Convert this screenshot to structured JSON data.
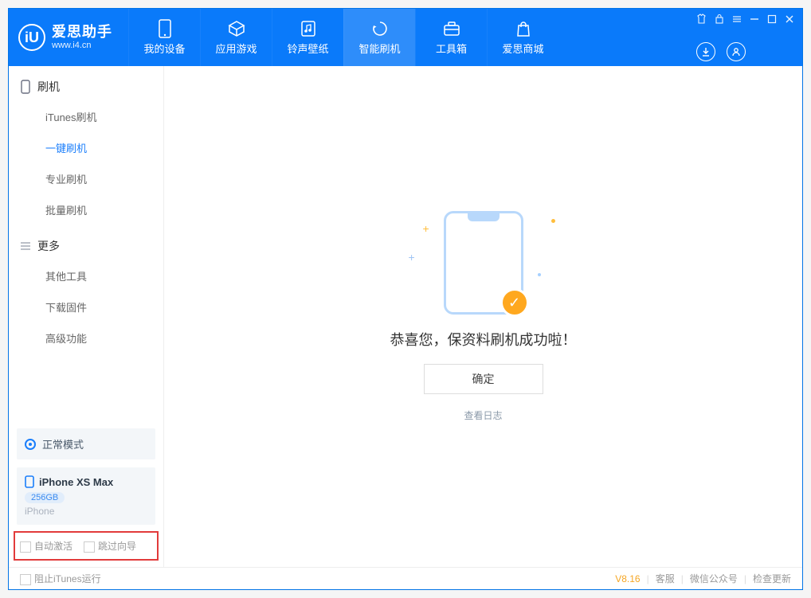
{
  "brand": {
    "name": "爱思助手",
    "domain": "www.i4.cn",
    "logo_letter": "iU"
  },
  "nav": {
    "items": [
      {
        "label": "我的设备"
      },
      {
        "label": "应用游戏"
      },
      {
        "label": "铃声壁纸"
      },
      {
        "label": "智能刷机"
      },
      {
        "label": "工具箱"
      },
      {
        "label": "爱思商城"
      }
    ]
  },
  "sidebar": {
    "group_flash": "刷机",
    "flash_items": [
      {
        "label": "iTunes刷机"
      },
      {
        "label": "一键刷机"
      },
      {
        "label": "专业刷机"
      },
      {
        "label": "批量刷机"
      }
    ],
    "group_more": "更多",
    "more_items": [
      {
        "label": "其他工具"
      },
      {
        "label": "下载固件"
      },
      {
        "label": "高级功能"
      }
    ],
    "mode": "正常模式",
    "device": {
      "name": "iPhone XS Max",
      "capacity": "256GB",
      "type": "iPhone"
    },
    "options": {
      "auto_activate": "自动激活",
      "skip_guide": "跳过向导"
    }
  },
  "main": {
    "success_title": "恭喜您，保资料刷机成功啦！",
    "ok_label": "确定",
    "log_link": "查看日志"
  },
  "footer": {
    "block_itunes": "阻止iTunes运行",
    "version": "V8.16",
    "links": [
      "客服",
      "微信公众号",
      "检查更新"
    ]
  }
}
